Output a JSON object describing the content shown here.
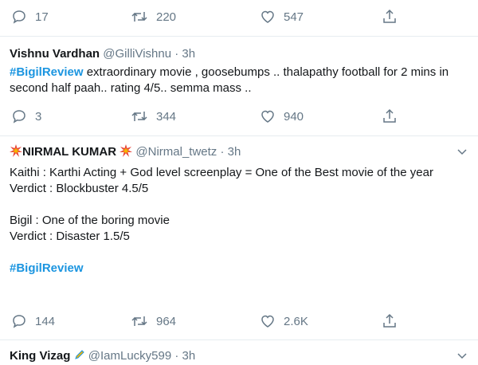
{
  "top_actions": {
    "replies": "17",
    "retweets": "220",
    "likes": "547"
  },
  "tweets": [
    {
      "name": "Vishnu Vardhan",
      "handle": "@GilliVishnu",
      "time": "· 3h",
      "hashtag": "#BigilReview",
      "text": " extraordinary movie , goosebumps .. thalapathy football for 2 mins in second half paah.. rating 4/5.. semma mass ..",
      "replies": "3",
      "retweets": "344",
      "likes": "940"
    },
    {
      "name": "NIRMAL KUMAR",
      "handle": "@Nirmal_twetz",
      "time": "· 3h",
      "lines": [
        "Kaithi : Karthi Acting + God level screenplay = One of the Best movie of the year",
        "Verdict : Blockbuster 4.5/5",
        "",
        "Bigil :  One of the boring movie",
        "Verdict : Disaster 1.5/5",
        ""
      ],
      "hashtag": "#BigilReview",
      "replies": "144",
      "retweets": "964",
      "likes": "2.6K"
    },
    {
      "name": "King Vizag",
      "handle": "@IamLucky599",
      "time": "· 3h"
    }
  ],
  "colors": {
    "accent": "#1b95e0",
    "muted": "#657786",
    "border": "#e6ecf0"
  }
}
